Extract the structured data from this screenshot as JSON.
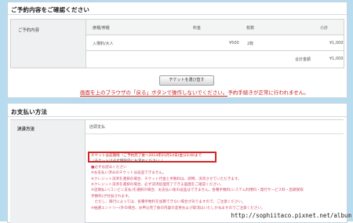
{
  "confirm_section": {
    "title": "ご予約内容をご確認ください",
    "order_label": "ご予約内容",
    "headers": {
      "kind": "席種/券種",
      "price": "料金",
      "count": "枚数",
      "subtotal": "小計"
    },
    "row": {
      "kind": "入場料/大人",
      "price": "¥500",
      "count": "2枚",
      "subtotal": "¥1,000"
    },
    "total_label": "合計金額",
    "total_value": "¥1,000"
  },
  "select_ticket_button": "チケットを選び直す",
  "notice": {
    "part1": "画面を上のブラウザの「戻る」ボタンで操作しないでください。",
    "part2": "予約手続きが正常に行われません。"
  },
  "payment_section": {
    "title": "お支払い方法",
    "method_label": "決済方法",
    "method_value": "店頭支払",
    "lines": [
      {
        "text": "チケットは前期限（ご予約完了後〜2014年01月14日(金)23:00まで",
        "style": "red"
      },
      {
        "text": "（チケットは必ず期限内にお求めください。）",
        "style": "gray"
      },
      {
        "text": "■必ずお読みください",
        "style": "pink"
      },
      {
        "text": "※お支払い済みのチケットは返品できません。",
        "style": "pink"
      },
      {
        "text": "※クレジット決済を選択の場合、チケット代金と手数料は、即時、決済させていただきます。",
        "style": "pink"
      },
      {
        "text": "※クレジット決済を選択の場合、必ず決済処理完了できる画面をご確認ください。",
        "style": "pink"
      },
      {
        "text": "※店頭払い(コンビニ支払)を選択の場合、お支払い後の返品はできません。各種手数料(システム利用料・発行サービス料・店頭受取",
        "style": "pink"
      },
      {
        "text": "手数料)が付加されます。",
        "style": "pink"
      },
      {
        "text": "　ただし、興行によっては、各種手数料を加算できない場合がありますので、ご注意ください。",
        "style": "pink"
      },
      {
        "text": "※抽選エントリー(外の場合、お申込完了後の内容の変更および取消はいたしかねますのでご注意ください。",
        "style": "pink"
      }
    ]
  },
  "watermark": "http://sophiitaco.pixnet.net/album"
}
